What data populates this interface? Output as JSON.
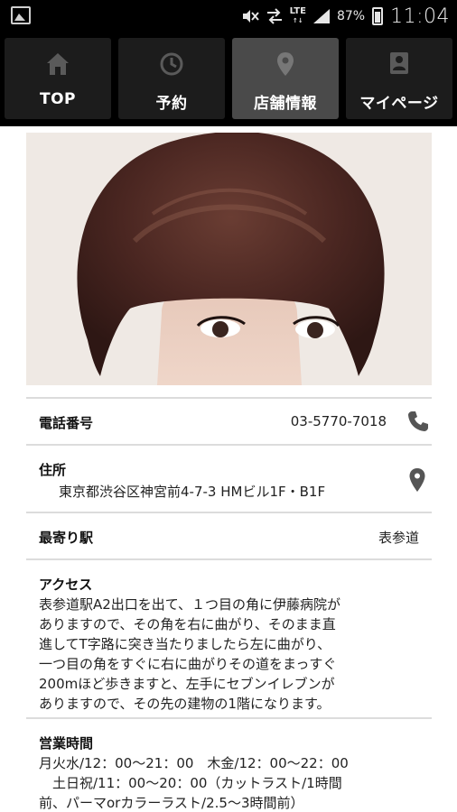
{
  "status_bar": {
    "battery": "87%",
    "network": "LTE",
    "time": "11:04",
    "icons": [
      "gallery-icon",
      "mute-icon",
      "data-transfer-icon",
      "signal-icon",
      "battery-icon"
    ]
  },
  "tabs": [
    {
      "label": "TOP",
      "icon": "home-icon",
      "active": false
    },
    {
      "label": "予約",
      "icon": "clock-icon",
      "active": false
    },
    {
      "label": "店舗情報",
      "icon": "map-pin-icon",
      "active": true
    },
    {
      "label": "マイページ",
      "icon": "person-card-icon",
      "active": false
    }
  ],
  "shop": {
    "phone_label": "電話番号",
    "phone": "03-5770-7018",
    "address_label": "住所",
    "address": "東京都渋谷区神宮前4-7-3 HMビル1F・B1F",
    "station_label": "最寄り駅",
    "station": "表参道",
    "access_label": "アクセス",
    "access_lines": [
      "表参道駅A2出口を出て、１つ目の角に伊藤病院が",
      "ありますので、その角を右に曲がり、そのまま直",
      "進してT字路に突き当たりましたら左に曲がり、",
      "一つ目の角をすぐに右に曲がりその道をまっすぐ",
      "200mほど歩きますと、左手にセブンイレブンが",
      "ありますので、その先の建物の1階になります。"
    ],
    "hours_label": "営業時間",
    "hours_lines": [
      "月火水/12：00～21：00　木金/12：00～22：00",
      "　土日祝/11：00～20：00（カットラスト/1時間",
      "前、パーマorカラーラスト/2.5～3時間前）"
    ]
  },
  "colors": {
    "bar_bg": "#000000",
    "tab_bg": "#1c1c1c",
    "tab_active_bg": "#4a4a4a",
    "icon_gray": "#555555",
    "divider": "#dcdcdc"
  }
}
